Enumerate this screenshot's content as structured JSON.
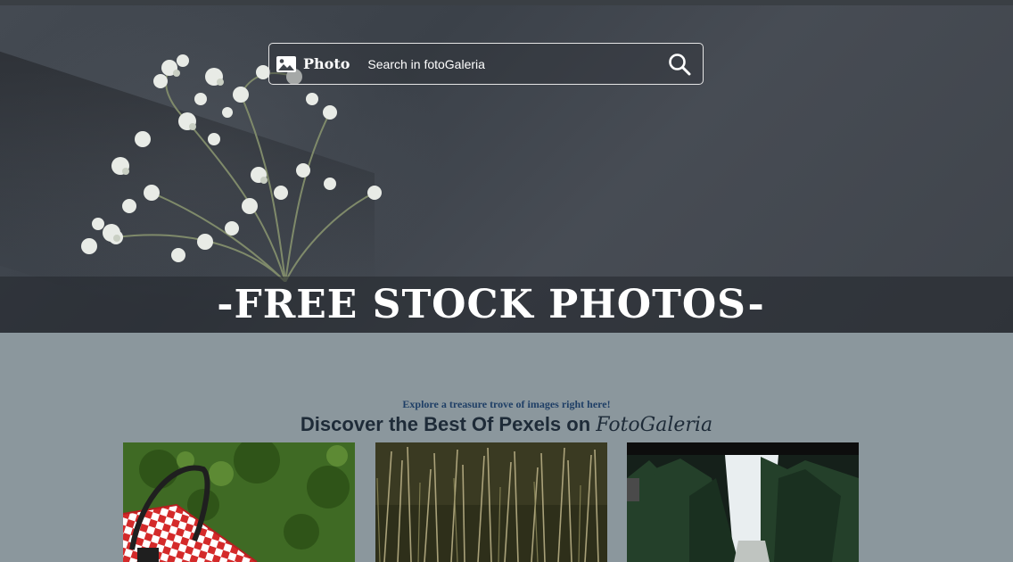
{
  "search": {
    "brand_label": "Photo",
    "placeholder": "Search in fotoGaleria"
  },
  "hero": {
    "title": "-FREE STOCK PHOTOS-"
  },
  "intro": {
    "tagline": "Explore a treasure trove of images right here!",
    "headline": "Discover the Best Of Pexels on ",
    "headline_brand": "FotoGaleria"
  },
  "icons": {
    "brand": "image-icon",
    "search": "search-icon"
  },
  "colors": {
    "page_background": "#8b979d",
    "tagline": "#1f3f66",
    "headline": "#1e2b38",
    "hero_text": "#ffffff"
  },
  "gallery": {
    "items": [
      {
        "subject": "picnic-blanket-on-grass"
      },
      {
        "subject": "tall-grass-field"
      },
      {
        "subject": "forest-road"
      }
    ]
  }
}
